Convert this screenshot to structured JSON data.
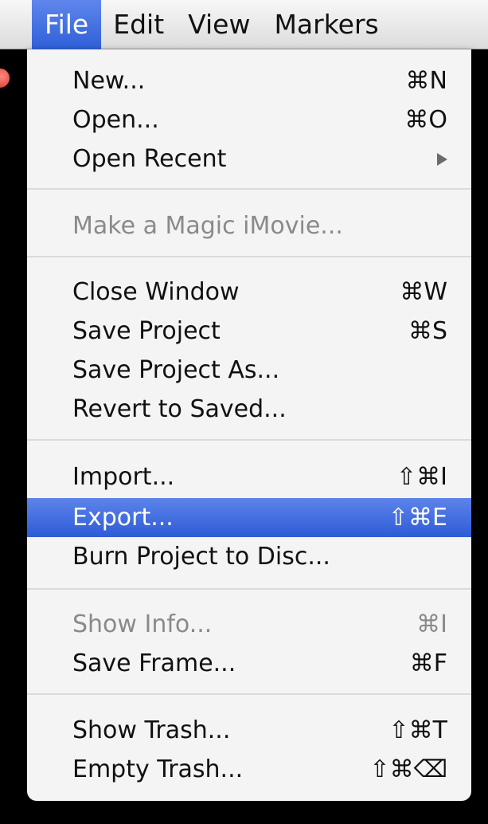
{
  "menubar": {
    "items": [
      "File",
      "Edit",
      "View",
      "Markers"
    ],
    "active": "File"
  },
  "file_menu": {
    "items": [
      {
        "label": "New...",
        "shortcut": "⌘N"
      },
      {
        "label": "Open...",
        "shortcut": "⌘O"
      },
      {
        "label": "Open Recent",
        "submenu": true
      },
      {
        "label": "Make a Magic iMovie...",
        "disabled": true
      },
      {
        "label": "Close Window",
        "shortcut": "⌘W"
      },
      {
        "label": "Save Project",
        "shortcut": "⌘S"
      },
      {
        "label": "Save Project As..."
      },
      {
        "label": "Revert to Saved..."
      },
      {
        "label": "Import...",
        "shortcut": "⇧⌘I"
      },
      {
        "label": "Export...",
        "shortcut": "⇧⌘E",
        "highlighted": true
      },
      {
        "label": "Burn Project to Disc..."
      },
      {
        "label": "Show Info...",
        "shortcut": "⌘I",
        "disabled": true
      },
      {
        "label": "Save Frame...",
        "shortcut": "⌘F"
      },
      {
        "label": "Show Trash...",
        "shortcut": "⇧⌘T"
      },
      {
        "label": "Empty Trash...",
        "shortcut": "⇧⌘⌫"
      }
    ]
  },
  "colors": {
    "highlight": "#3a67dd",
    "menu_background": "#f4f4f4",
    "disabled_text": "#8a8a8a"
  }
}
